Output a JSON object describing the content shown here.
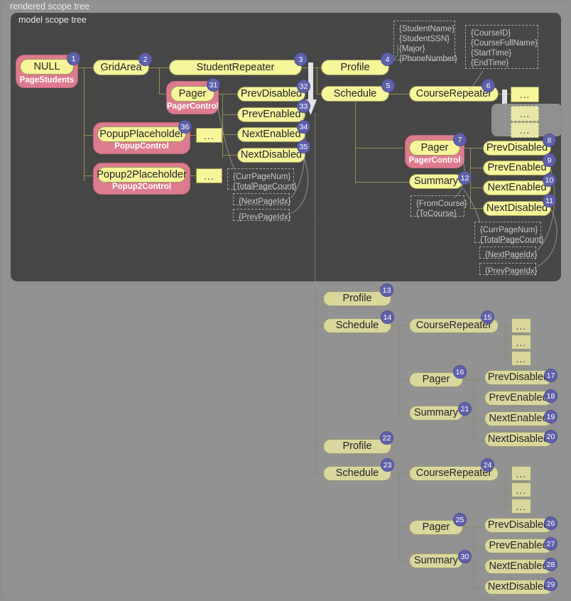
{
  "panels": {
    "outer_label": "rendered scope tree",
    "inner_label": "model scope tree"
  },
  "colors": {
    "outer_panel": "#929292",
    "inner_panel": "#464646",
    "node_yellow": "#f7f59a",
    "node_muted": "#d9d79c",
    "wrapper_pink": "#dd7b8e",
    "badge_blue": "#5f60aa",
    "connector": "#8f8f52",
    "arrow": "#e4e4e4"
  },
  "nodes": {
    "n1": {
      "label": "NULL",
      "badge": "1",
      "wrapper": "PageStudents"
    },
    "n2": {
      "label": "GridArea",
      "badge": "2"
    },
    "n3": {
      "label": "StudentRepeater",
      "badge": "3"
    },
    "n4": {
      "label": "Profile",
      "badge": "4"
    },
    "n5": {
      "label": "Schedule",
      "badge": "5"
    },
    "n6": {
      "label": "CourseRepeater",
      "badge": "6"
    },
    "n7": {
      "label": "Pager",
      "badge": "7",
      "wrapper": "PagerControl"
    },
    "n8": {
      "label": "PrevDisabled",
      "badge": "8"
    },
    "n9": {
      "label": "PrevEnabled",
      "badge": "9"
    },
    "n10": {
      "label": "NextEnabled",
      "badge": "10"
    },
    "n11": {
      "label": "NextDisabled",
      "badge": "11"
    },
    "n12": {
      "label": "Summary",
      "badge": "12"
    },
    "n13": {
      "label": "Profile",
      "badge": "13"
    },
    "n14": {
      "label": "Schedule",
      "badge": "14"
    },
    "n15": {
      "label": "CourseRepeater",
      "badge": "15"
    },
    "n16": {
      "label": "Pager",
      "badge": "16"
    },
    "n17": {
      "label": "PrevDisabled",
      "badge": "17"
    },
    "n18": {
      "label": "PrevEnabled",
      "badge": "18"
    },
    "n19": {
      "label": "NextEnabled",
      "badge": "19"
    },
    "n20": {
      "label": "NextDisabled",
      "badge": "20"
    },
    "n21": {
      "label": "Summary",
      "badge": "21"
    },
    "n22": {
      "label": "Profile",
      "badge": "22"
    },
    "n23": {
      "label": "Schedule",
      "badge": "23"
    },
    "n24": {
      "label": "CourseRepeater",
      "badge": "24"
    },
    "n25": {
      "label": "Pager",
      "badge": "25"
    },
    "n26": {
      "label": "PrevDisabled",
      "badge": "26"
    },
    "n27": {
      "label": "PrevEnabled",
      "badge": "27"
    },
    "n28": {
      "label": "NextEnabled",
      "badge": "28"
    },
    "n29": {
      "label": "NextDisabled",
      "badge": "29"
    },
    "n30": {
      "label": "Summary",
      "badge": "30"
    },
    "n31": {
      "label": "Pager",
      "badge": "31",
      "wrapper": "PagerControl"
    },
    "n32": {
      "label": "PrevDisabled",
      "badge": "32"
    },
    "n33": {
      "label": "PrevEnabled",
      "badge": "33"
    },
    "n34": {
      "label": "NextEnabled",
      "badge": "34"
    },
    "n35": {
      "label": "NextDisabled",
      "badge": "35"
    },
    "n36": {
      "label": "PopupPlaceholder",
      "badge": "36",
      "wrapper": "PopupControl"
    },
    "n37": {
      "label": "Popup2Placeholder",
      "wrapper": "Popup2Control"
    }
  },
  "repeater_dots": {
    "d1": "...",
    "d2": "...",
    "d3": "...",
    "d4": "...",
    "d5": "...",
    "d6": "...",
    "d7": "...",
    "d8": "...",
    "d9": "...",
    "d10": "...",
    "d11": "...",
    "d12": "...",
    "d13": "..."
  },
  "attr_boxes": {
    "student": "{StudentName}\n{StudentSSN}\n{Major}\n{PhoneNumber}",
    "course": "{CourseID}\n{CourseFullName}\n{StartTime}\n{EndTime}",
    "top_pager": "{CurrPageNum}\n{TotalPageCount}",
    "top_next": "{NextPageIdx}",
    "top_prev": "{PrevPageIdx}",
    "course_pager": "{CurrPageNum}\n{TotalPageCount}",
    "course_next": "{NextPageIdx}",
    "course_prev": "{PrevPageIdx}",
    "summary": "{FromCourse}\n{ToCourse}"
  }
}
